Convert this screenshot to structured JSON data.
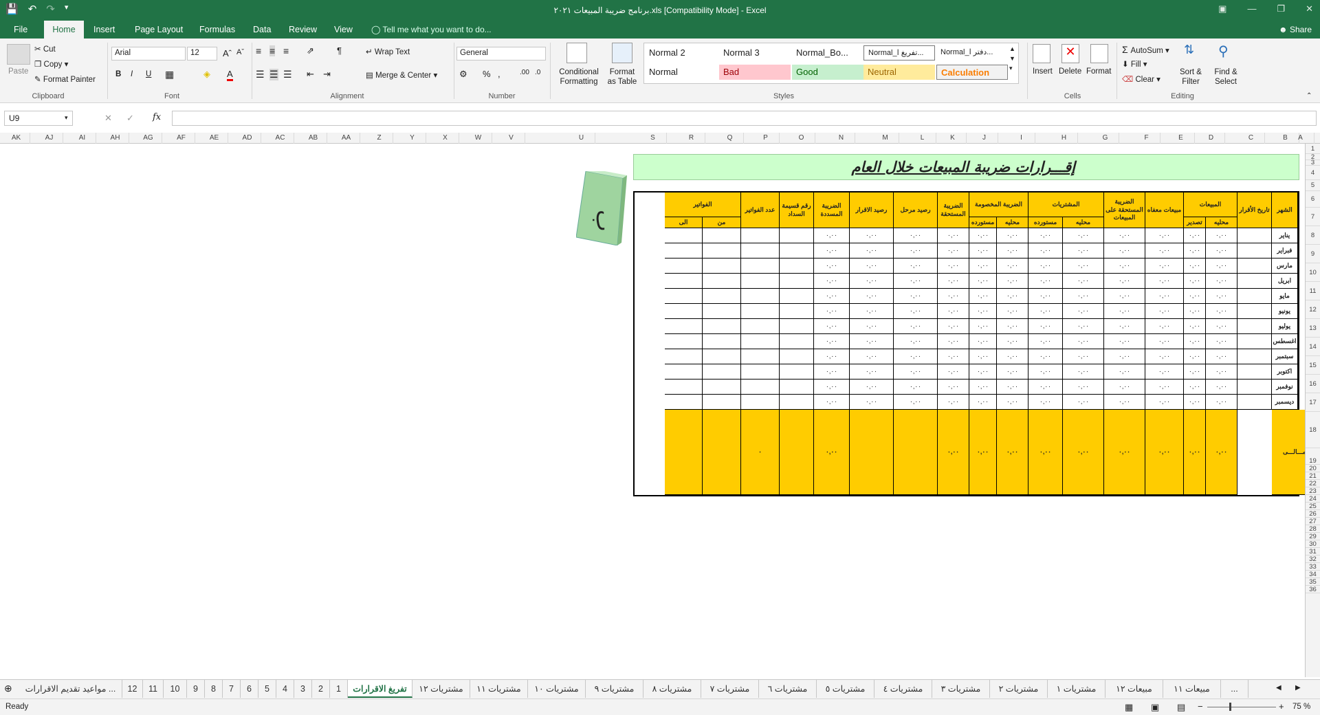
{
  "window": {
    "title": "برنامج ضريبة المبيعات ٢٠٢١.xls  [Compatibility Mode] - Excel"
  },
  "ribbon_tabs": [
    "File",
    "Home",
    "Insert",
    "Page Layout",
    "Formulas",
    "Data",
    "Review",
    "View"
  ],
  "tell_me": "Tell me what you want to do...",
  "share": "Share",
  "clipboard": {
    "paste": "Paste",
    "cut": "Cut",
    "copy": "Copy",
    "format_painter": "Format Painter",
    "label": "Clipboard"
  },
  "font": {
    "name": "Arial",
    "size": "12",
    "label": "Font"
  },
  "alignment": {
    "wrap": "Wrap Text",
    "merge": "Merge & Center",
    "label": "Alignment"
  },
  "number": {
    "format": "General",
    "label": "Number"
  },
  "styles": {
    "cond": "Conditional Formatting",
    "table": "Format as Table",
    "label": "Styles",
    "cells": [
      {
        "name": "Normal 2",
        "bg": "#ffffff",
        "fg": "#222222"
      },
      {
        "name": "Normal 3",
        "bg": "#ffffff",
        "fg": "#222222"
      },
      {
        "name": "Normal_Bo...",
        "bg": "#ffffff",
        "fg": "#222222"
      },
      {
        "name": "Normal_تفريغ ا...",
        "bg": "#ffffff",
        "fg": "#222222"
      },
      {
        "name": "Normal_دفتر ا...",
        "bg": "#ffffff",
        "fg": "#222222"
      },
      {
        "name": "Normal",
        "bg": "#ffffff",
        "fg": "#222222"
      },
      {
        "name": "Bad",
        "bg": "#ffc7ce",
        "fg": "#9c0006"
      },
      {
        "name": "Good",
        "bg": "#c6efce",
        "fg": "#006100"
      },
      {
        "name": "Neutral",
        "bg": "#ffeb9c",
        "fg": "#9c6500"
      },
      {
        "name": "Calculation",
        "bg": "#f2f2f2",
        "fg": "#fa7d00"
      }
    ]
  },
  "cells_grp": {
    "insert": "Insert",
    "delete": "Delete",
    "format": "Format",
    "label": "Cells"
  },
  "editing": {
    "autosum": "AutoSum",
    "fill": "Fill",
    "clear": "Clear",
    "sort": "Sort & Filter",
    "find": "Find & Select",
    "label": "Editing"
  },
  "namebox": "U9",
  "columns": [
    "AK",
    "AJ",
    "AI",
    "AH",
    "AG",
    "AF",
    "AE",
    "AD",
    "AC",
    "AB",
    "AA",
    "Z",
    "Y",
    "X",
    "W",
    "V",
    "U",
    "S",
    "R",
    "Q",
    "P",
    "O",
    "N",
    "M",
    "L",
    "K",
    "J",
    "I",
    "H",
    "G",
    "F",
    "E",
    "D",
    "C",
    "B",
    "A"
  ],
  "rows": [
    "1",
    "2",
    "3",
    "4",
    "5",
    "6",
    "7",
    "8",
    "9",
    "10",
    "11",
    "12",
    "13",
    "14",
    "15",
    "16",
    "17",
    "18",
    "19",
    "20",
    "21",
    "22",
    "23",
    "24",
    "25",
    "26",
    "27",
    "28",
    "29",
    "30",
    "31",
    "32",
    "33",
    "34",
    "35",
    "36"
  ],
  "sheet_title": "إقـــرارات ضريبة المبيعات خلال العام",
  "table": {
    "headers": {
      "month": "الشهر",
      "date": "تاريخ الأقرار",
      "sales": "المبيعات",
      "sales_local": "محليه",
      "sales_export": "تصدير",
      "exempt": "مبيعات معفاه",
      "due_tax": "الضريبة المستحقة على المبيعات",
      "purchases": "المشتريات",
      "pur_local": "محليه",
      "pur_import": "مستورده",
      "deducted": "الضريبة المخصومة",
      "ded_local": "محليه",
      "ded_import": "مستورده",
      "tax_due": "الضريبة المستحقة",
      "carried": "رصيد مرحل",
      "balance": "رصيد الاقرار",
      "paid": "الضريبة المسددة",
      "receipt": "رقم قسيمة السداد",
      "inv_count": "عدد الفواتير",
      "invoices": "الفواتير",
      "inv_from": "من",
      "inv_to": "الى"
    },
    "months": [
      "يناير",
      "فبراير",
      "مارس",
      "ابريل",
      "مايو",
      "يونيو",
      "يوليو",
      "اغسطس",
      "سبتمبر",
      "اكتوبر",
      "نوفمبر",
      "ديسمبر"
    ],
    "zero": "٠,٠٠",
    "total_label": "الاجـــمـــالـــى",
    "total_count": "٠"
  },
  "sheet_tabs": [
    "مواعيد تقديم الاقرارات ...",
    "12",
    "11",
    "10",
    "9",
    "8",
    "7",
    "6",
    "5",
    "4",
    "3",
    "2",
    "1",
    "تفريغ الاقرارات",
    "مشتريات ١٢",
    "مشتريات ١١",
    "مشتريات ١٠",
    "مشتريات ٩",
    "مشتريات ٨",
    "مشتريات ٧",
    "مشتريات ٦",
    "مشتريات ٥",
    "مشتريات ٤",
    "مشتريات ٣",
    "مشتريات ٢",
    "مشتريات ١",
    "مبيعات ١٢",
    "مبيعات ١١",
    "..."
  ],
  "status": {
    "ready": "Ready",
    "zoom": "75 %"
  }
}
